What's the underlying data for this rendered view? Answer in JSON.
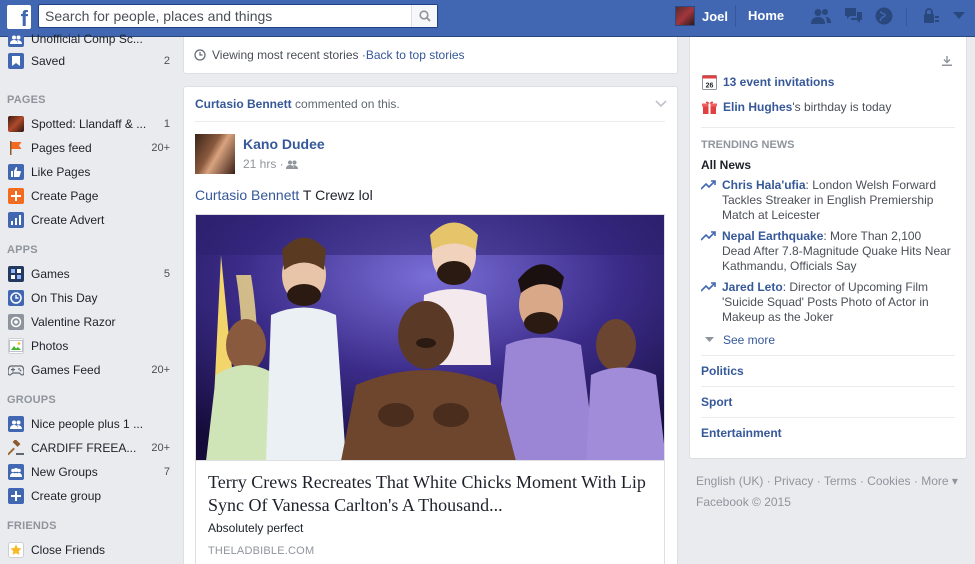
{
  "topbar": {
    "logo": "f",
    "search_placeholder": "Search for people, places and things",
    "profile_name": "Joel",
    "home_label": "Home"
  },
  "left_nav": {
    "top_items": [
      {
        "label": "Unofficial Comp Sc...",
        "count": "",
        "icon": "group-icon"
      },
      {
        "label": "Saved",
        "count": "2",
        "icon": "bookmark-icon"
      }
    ],
    "pages_header": "PAGES",
    "pages": [
      {
        "label": "Spotted: Llandaff & ...",
        "count": "1",
        "icon": "page-thumb-icon"
      },
      {
        "label": "Pages feed",
        "count": "20+",
        "icon": "flag-icon"
      },
      {
        "label": "Like Pages",
        "count": "",
        "icon": "like-icon"
      },
      {
        "label": "Create Page",
        "count": "",
        "icon": "create-page-icon"
      },
      {
        "label": "Create Advert",
        "count": "",
        "icon": "advert-icon"
      }
    ],
    "apps_header": "APPS",
    "apps": [
      {
        "label": "Games",
        "count": "5",
        "icon": "games-icon"
      },
      {
        "label": "On This Day",
        "count": "",
        "icon": "clock-icon"
      },
      {
        "label": "Valentine Razor",
        "count": "",
        "icon": "app-icon"
      },
      {
        "label": "Photos",
        "count": "",
        "icon": "photos-icon"
      },
      {
        "label": "Games Feed",
        "count": "20+",
        "icon": "gamepad-icon"
      }
    ],
    "groups_header": "GROUPS",
    "groups": [
      {
        "label": "Nice people plus 1 ...",
        "count": "",
        "icon": "group-icon"
      },
      {
        "label": "CARDIFF FREEA...",
        "count": "20+",
        "icon": "gavel-icon"
      },
      {
        "label": "New Groups",
        "count": "7",
        "icon": "new-groups-icon"
      },
      {
        "label": "Create group",
        "count": "",
        "icon": "create-group-icon"
      }
    ],
    "friends_header": "FRIENDS",
    "friends": [
      {
        "label": "Close Friends",
        "count": "",
        "icon": "star-icon"
      }
    ]
  },
  "feed": {
    "recent_text": "Viewing most recent stories · ",
    "back_link": "Back to top stories",
    "post": {
      "commenter": "Curtasio Bennett",
      "commented_text": " commented on this.",
      "author": "Kano Dudee",
      "time": "21 hrs · ",
      "body_link": "Curtasio Bennett",
      "body_text": " T Crewz lol",
      "link_title": "Terry Crews Recreates That White Chicks Moment With Lip Sync Of Vanessa Carlton's A Thousand...",
      "link_desc": "Absolutely perfect",
      "link_domain": "THELADBIBLE.COM"
    }
  },
  "right": {
    "event_invites": "13 event invitations",
    "event_date": "26",
    "birthday_name": "Elin Hughes",
    "birthday_text": "'s birthday is today",
    "trending_header": "TRENDING NEWS",
    "trending_tab": "All News",
    "trending": [
      {
        "name": "Chris Hala'ufia",
        "text": ": London Welsh Forward Tackles Streaker in English Premiership Match at Leicester"
      },
      {
        "name": "Nepal Earthquake",
        "text": ": More Than 2,100 Dead After 7.8-Magnitude Quake Hits Near Kathmandu, Officials Say"
      },
      {
        "name": "Jared Leto",
        "text": ": Director of Upcoming Film 'Suicide Squad' Posts Photo of Actor in Makeup as the Joker"
      }
    ],
    "see_more": "See more",
    "categories": [
      "Politics",
      "Sport",
      "Entertainment"
    ]
  },
  "footer": {
    "links": [
      "English (UK)",
      "Privacy",
      "Terms",
      "Cookies",
      "More"
    ],
    "more_suffix": " ▾",
    "copyright": "Facebook © 2015"
  },
  "colors": {
    "brand": "#4267b2",
    "link": "#365899",
    "background": "#e9ebee"
  }
}
